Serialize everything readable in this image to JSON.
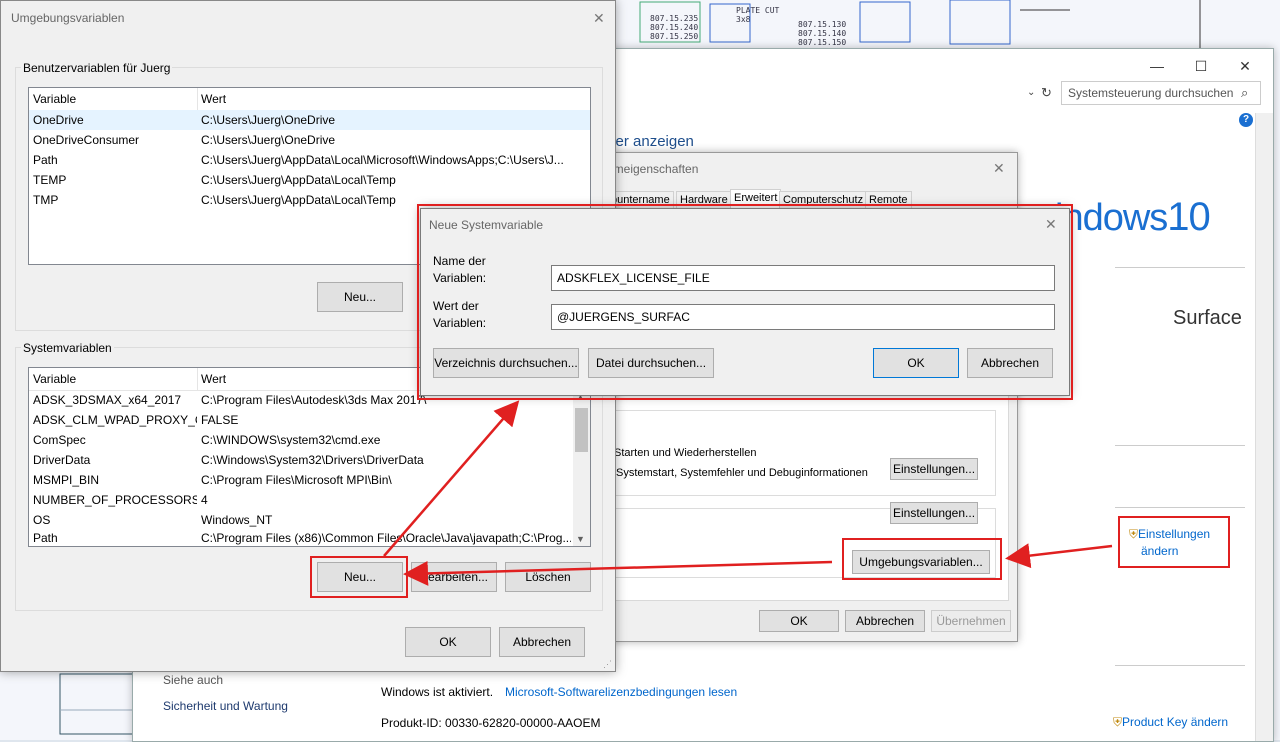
{
  "cad": {
    "labels": [
      "807.15.235\n807.15.240\n807.15.250",
      "807.15.130\n807.15.140\n807.15.150",
      "PLATE CUT\n3x8"
    ]
  },
  "system_window": {
    "search_placeholder": "Systemsteuerung durchsuchen",
    "heading_partial": "uter anzeigen",
    "windows_logo": "Windows 10",
    "windows_logo_partial": "indows",
    "windows_logo_number": "10",
    "surface_logo": "Surface",
    "settings_link": "Einstellungen ändern",
    "settings_link_l1": "Einstellungen",
    "settings_link_l2": "ändern",
    "see_also": "Siehe auch",
    "security_link": "Sicherheit und Wartung",
    "activated": "Windows ist aktiviert.",
    "license_link": "Microsoft-Softwarelizenzbedingungen lesen",
    "product_id": "Produkt-ID:  00330-62820-00000-AAOEM",
    "product_key_link": "Product Key ändern",
    "minimize": "—",
    "maximize": "☐",
    "close": "✕",
    "help": "?"
  },
  "sys_properties": {
    "title_partial": "emeigenschaften",
    "tabs": [
      "puntername",
      "Hardware",
      "Erweitert",
      "Computerschutz",
      "Remote"
    ],
    "settings_btn": "Einstellungen...",
    "startup_group": "Starten und Wiederherstellen",
    "startup_desc": "Systemstart, Systemfehler und Debuginformationen",
    "settings_btn2": "Einstellungen...",
    "env_btn": "Umgebungsvariablen...",
    "ok": "OK",
    "cancel": "Abbrechen",
    "apply": "Übernehmen",
    "close": "✕"
  },
  "env_window": {
    "title": "Umgebungsvariablen",
    "close": "✕",
    "user_group": "Benutzervariablen für Juerg",
    "col_var": "Variable",
    "col_val": "Wert",
    "user_vars": [
      {
        "name": "OneDrive",
        "value": "C:\\Users\\Juerg\\OneDrive"
      },
      {
        "name": "OneDriveConsumer",
        "value": "C:\\Users\\Juerg\\OneDrive"
      },
      {
        "name": "Path",
        "value": "C:\\Users\\Juerg\\AppData\\Local\\Microsoft\\WindowsApps;C:\\Users\\J..."
      },
      {
        "name": "TEMP",
        "value": "C:\\Users\\Juerg\\AppData\\Local\\Temp"
      },
      {
        "name": "TMP",
        "value": "C:\\Users\\Juerg\\AppData\\Local\\Temp"
      }
    ],
    "user_new": "Neu...",
    "sys_group": "Systemvariablen",
    "sys_vars": [
      {
        "name": "ADSK_3DSMAX_x64_2017",
        "value": "C:\\Program Files\\Autodesk\\3ds Max 2017\\"
      },
      {
        "name": "ADSK_CLM_WPAD_PROXY_C...",
        "value": "FALSE"
      },
      {
        "name": "ComSpec",
        "value": "C:\\WINDOWS\\system32\\cmd.exe"
      },
      {
        "name": "DriverData",
        "value": "C:\\Windows\\System32\\Drivers\\DriverData"
      },
      {
        "name": "MSMPI_BIN",
        "value": "C:\\Program Files\\Microsoft MPI\\Bin\\"
      },
      {
        "name": "NUMBER_OF_PROCESSORS",
        "value": "4"
      },
      {
        "name": "OS",
        "value": "Windows_NT"
      },
      {
        "name": "Path",
        "value": "C:\\Program Files (x86)\\Common Files\\Oracle\\Java\\javapath;C:\\Prog..."
      }
    ],
    "sys_new": "Neu...",
    "sys_edit": "Bearbeiten...",
    "sys_delete": "Löschen",
    "ok": "OK",
    "cancel": "Abbrechen"
  },
  "new_var": {
    "title": "Neue Systemvariable",
    "close": "✕",
    "name_label_1": "Name der",
    "name_label_2": "Variablen:",
    "name_value": "ADSKFLEX_LICENSE_FILE",
    "value_label_1": "Wert der",
    "value_label_2": "Variablen:",
    "value_value": "@JUERGENS_SURFAC",
    "browse_dir": "Verzeichnis durchsuchen...",
    "browse_file": "Datei durchsuchen...",
    "ok": "OK",
    "cancel": "Abbrechen"
  },
  "colors": {
    "annotation_red": "#e02020",
    "link_blue": "#0066cc",
    "accent": "#0078d7"
  }
}
